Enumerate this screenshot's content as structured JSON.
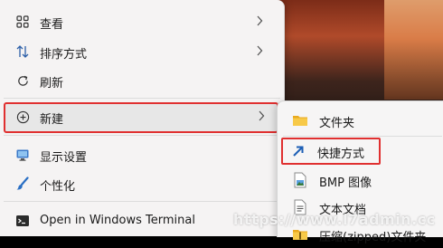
{
  "context_menu": {
    "items": [
      {
        "label": "查看",
        "icon": "grid-icon",
        "has_submenu": true
      },
      {
        "label": "排序方式",
        "icon": "sort-arrows-icon",
        "has_submenu": true
      },
      {
        "label": "刷新",
        "icon": "refresh-icon",
        "has_submenu": false
      },
      {
        "label": "新建",
        "icon": "add-circle-icon",
        "has_submenu": true
      },
      {
        "label": "显示设置",
        "icon": "display-icon",
        "has_submenu": false
      },
      {
        "label": "个性化",
        "icon": "brush-icon",
        "has_submenu": false
      },
      {
        "label": "Open in Windows Terminal",
        "icon": "terminal-icon",
        "has_submenu": false
      }
    ]
  },
  "new_submenu": {
    "items": [
      {
        "label": "文件夹",
        "icon": "folder-icon"
      },
      {
        "label": "快捷方式",
        "icon": "shortcut-arrow-icon"
      },
      {
        "label": "BMP 图像",
        "icon": "bmp-image-icon"
      },
      {
        "label": "文本文档",
        "icon": "text-document-icon"
      },
      {
        "label": "压缩(zipped)文件夹",
        "icon": "zip-folder-icon"
      }
    ]
  },
  "watermark": "https://www.l7admin.cc",
  "colors": {
    "highlight_border": "#e03030",
    "menu_bg": "#f5f3f3",
    "folder": "#f2b92c",
    "shortcut_arrow": "#1d5fb5"
  }
}
